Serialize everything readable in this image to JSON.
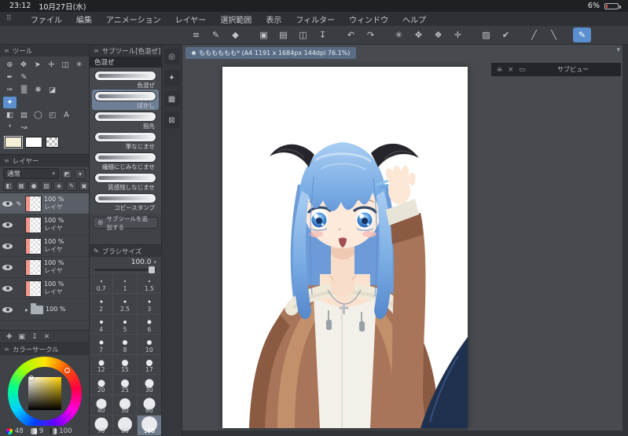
{
  "status_bar": {
    "time": "23:12",
    "date": "10月27日(水)",
    "battery_percent": "6%"
  },
  "menu_bar": {
    "items": [
      "ファイル",
      "編集",
      "アニメーション",
      "レイヤー",
      "選択範囲",
      "表示",
      "フィルター",
      "ウィンドウ",
      "ヘルプ"
    ]
  },
  "toolbar": {
    "buttons": [
      {
        "name": "main-menu",
        "glyph": "≡"
      },
      {
        "name": "current-tool",
        "glyph": "✎"
      },
      {
        "name": "tool-switch",
        "glyph": "◆"
      },
      {
        "name": "clipboard",
        "glyph": "▣",
        "gap": true
      },
      {
        "name": "new-canvas",
        "glyph": "▤"
      },
      {
        "name": "import",
        "glyph": "◫"
      },
      {
        "name": "export",
        "glyph": "↧"
      },
      {
        "name": "undo",
        "glyph": "↶",
        "gap": true
      },
      {
        "name": "redo",
        "glyph": "↷"
      },
      {
        "name": "deselect",
        "glyph": "✳",
        "gap": true
      },
      {
        "name": "transform",
        "glyph": "✥"
      },
      {
        "name": "snap",
        "glyph": "❖"
      },
      {
        "name": "ruler",
        "glyph": "✛"
      },
      {
        "name": "screentone",
        "glyph": "▨",
        "gap": true
      },
      {
        "name": "select-check",
        "glyph": "✔"
      },
      {
        "name": "stabilize-line",
        "glyph": "╱",
        "gap": true
      },
      {
        "name": "vector-line",
        "glyph": "╲"
      },
      {
        "name": "brush-mode",
        "glyph": "✎",
        "active": true,
        "gap": true
      }
    ]
  },
  "document_tab": {
    "title": "もももももも* (A4 1191 x 1684px 144dpi 76.1%)"
  },
  "canvas_area": {
    "collapse_glyph": "▾"
  },
  "tool_panel": {
    "title": "ツール",
    "rows": [
      [
        {
          "name": "zoom",
          "glyph": "⊕"
        },
        {
          "name": "navigate",
          "glyph": "✥"
        },
        {
          "name": "operate",
          "glyph": "➤"
        },
        {
          "name": "layer-move",
          "glyph": "✛"
        },
        {
          "name": "selection",
          "glyph": "◫"
        },
        {
          "name": "auto-select",
          "glyph": "✳"
        }
      ],
      [
        {
          "name": "pen",
          "glyph": "✒"
        },
        {
          "name": "pencil",
          "glyph": "✎"
        }
      ],
      [
        {
          "name": "brush",
          "glyph": "✑"
        },
        {
          "name": "airbrush",
          "glyph": "▒"
        },
        {
          "name": "decoration",
          "glyph": "❋"
        },
        {
          "name": "eraser",
          "glyph": "◪"
        }
      ],
      [
        {
          "name": "blend",
          "glyph": "✦",
          "active": true
        }
      ],
      [
        {
          "name": "fill",
          "glyph": "◧"
        },
        {
          "name": "gradient",
          "glyph": "▤"
        },
        {
          "name": "figure",
          "glyph": "◯"
        },
        {
          "name": "frame-border",
          "glyph": "◰"
        },
        {
          "name": "text",
          "glyph": "A"
        }
      ],
      [
        {
          "name": "balloon",
          "glyph": "❛"
        },
        {
          "name": "line-correction",
          "glyph": "↝"
        }
      ]
    ],
    "main_color": "#f5eed6",
    "sub_color": "#ffffff"
  },
  "subtool_panel": {
    "title": "サブツール[色混ぜ]",
    "group_label": "色混ぜ",
    "items": [
      {
        "label": "色混ぜ"
      },
      {
        "label": "ぼかし",
        "selected": true
      },
      {
        "label": "指先"
      },
      {
        "label": "筆なじませ"
      },
      {
        "label": "繊細にじみなじませ"
      },
      {
        "label": "質感残しなじませ"
      },
      {
        "label": "コピースタンプ"
      }
    ],
    "add_button_label": "サブツールを追加する"
  },
  "brush_size_panel": {
    "title": "ブラシサイズ",
    "current_value": "100.0",
    "sizes": [
      "0.7",
      "1",
      "1.5",
      "2",
      "2.5",
      "3",
      "4",
      "5",
      "6",
      "7",
      "8",
      "10",
      "12",
      "15",
      "17",
      "20",
      "25",
      "30",
      "40",
      "50",
      "60",
      "70",
      "80",
      "100"
    ],
    "selected": "100"
  },
  "layer_panel": {
    "title": "レイヤー",
    "blend_mode": "通常",
    "control_icons": [
      {
        "name": "layer-mask",
        "glyph": "◧"
      },
      {
        "name": "clipping",
        "glyph": "▦"
      },
      {
        "name": "lock-layer",
        "glyph": "●"
      },
      {
        "name": "lock-transparency",
        "glyph": "▨"
      },
      {
        "name": "reference-layer",
        "glyph": "◈"
      },
      {
        "name": "draft-layer",
        "glyph": "✎"
      },
      {
        "name": "outline",
        "glyph": "▣"
      }
    ],
    "footer_icons": [
      {
        "name": "new-layer",
        "glyph": "✚"
      },
      {
        "name": "new-folder",
        "glyph": "▣"
      },
      {
        "name": "merge-down",
        "glyph": "↧"
      },
      {
        "name": "delete-layer",
        "glyph": "✕"
      }
    ],
    "layers": [
      {
        "opacity": "100 %",
        "name": "レイヤ",
        "selected": true
      },
      {
        "opacity": "100 %",
        "name": "レイヤ"
      },
      {
        "opacity": "100 %",
        "name": "レイヤ"
      },
      {
        "opacity": "100 %",
        "name": "レイヤ"
      },
      {
        "opacity": "100 %",
        "name": "レイヤ"
      },
      {
        "opacity": "100 %",
        "name": "",
        "folder": true
      }
    ]
  },
  "color_panel": {
    "title": "カラーサークル",
    "values": [
      {
        "name": "hue",
        "value": "48"
      },
      {
        "name": "saturation",
        "value": "9"
      },
      {
        "name": "brightness",
        "value": "100"
      }
    ]
  },
  "dock": {
    "icons": [
      {
        "name": "quick-access",
        "glyph": "◎"
      },
      {
        "name": "color-history",
        "glyph": "✦"
      },
      {
        "name": "color-set",
        "glyph": "▦"
      },
      {
        "name": "close-dock",
        "glyph": "⊠"
      }
    ]
  },
  "subview_panel": {
    "title": "サブビュー",
    "icons": [
      {
        "name": "panel-menu",
        "glyph": "≡"
      },
      {
        "name": "close-panel",
        "glyph": "×"
      },
      {
        "name": "collapse-panel",
        "glyph": "▭"
      }
    ]
  },
  "colors": {
    "accent_blue": "#5b8fd0",
    "selected_color": "#f5eed6",
    "canvas_bg": "#474a4f",
    "doc_tab_bg": "#5a6d85"
  }
}
